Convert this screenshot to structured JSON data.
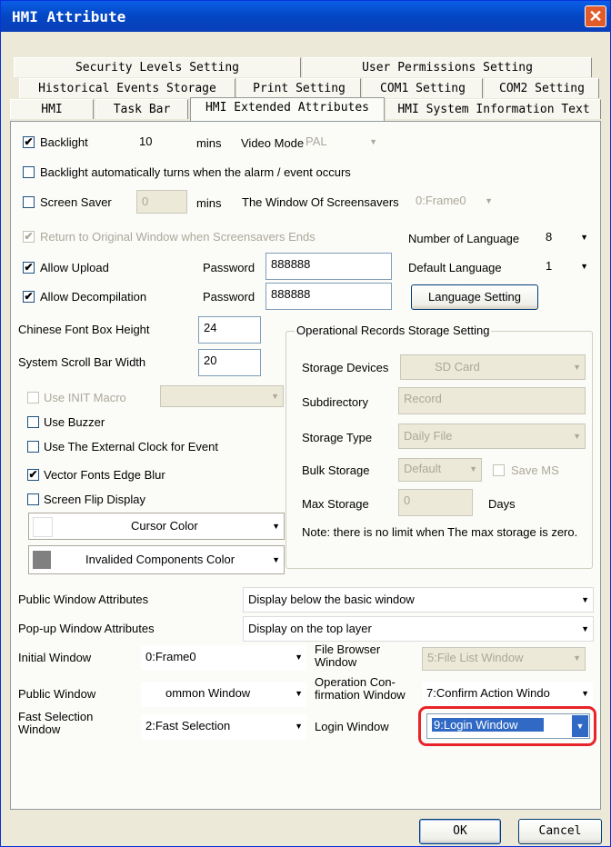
{
  "window": {
    "title": "HMI Attribute",
    "close_label": "✕"
  },
  "tabs": {
    "row1": [
      "Security Levels Setting",
      "User Permissions Setting"
    ],
    "row2": [
      "Historical Events Storage",
      "Print Setting",
      "COM1 Setting",
      "COM2 Setting"
    ],
    "row3": [
      "HMI",
      "Task Bar",
      "HMI Extended Attributes",
      "HMI System Information Text"
    ],
    "active": "HMI Extended Attributes"
  },
  "left": {
    "backlight": {
      "label": "Backlight",
      "checked": true,
      "value": "10",
      "unit": "mins"
    },
    "video_mode": {
      "label": "Video Mode",
      "value": "PAL"
    },
    "backlight_alarm": {
      "label": "Backlight automatically turns when the alarm / event occurs",
      "checked": false
    },
    "screen_saver": {
      "label": "Screen Saver",
      "checked": false,
      "value": "0",
      "unit": "mins"
    },
    "screensaver_window": {
      "label": "The Window Of Screensavers",
      "value": "0:Frame0"
    },
    "return_original": {
      "label": "Return to Original Window when Screensavers Ends",
      "checked": true
    },
    "allow_upload": {
      "label": "Allow Upload",
      "checked": true,
      "password_label": "Password",
      "password": "888888"
    },
    "allow_decompilation": {
      "label": "Allow Decompilation",
      "checked": true,
      "password_label": "Password",
      "password": "888888"
    },
    "font_box_height": {
      "label": "Chinese Font Box Height",
      "value": "24"
    },
    "scroll_bar_width": {
      "label": "System Scroll Bar Width",
      "value": "20"
    },
    "use_init_macro": {
      "label": "Use INIT Macro",
      "checked": false
    },
    "use_buzzer": {
      "label": "Use Buzzer",
      "checked": false
    },
    "external_clock": {
      "label": "Use The External Clock for Event",
      "checked": false
    },
    "vector_fonts": {
      "label": "Vector Fonts Edge Blur",
      "checked": true
    },
    "screen_flip": {
      "label": "Screen Flip Display",
      "checked": false
    },
    "cursor_color": {
      "label": "Cursor Color",
      "swatch": "#ffffff"
    },
    "invalided_color": {
      "label": "Invalided Components Color",
      "swatch": "#808080"
    }
  },
  "right": {
    "num_language": {
      "label": "Number of Language",
      "value": "8"
    },
    "default_language": {
      "label": "Default Language",
      "value": "1"
    },
    "language_button": "Language Setting",
    "records": {
      "title": "Operational Records Storage Setting",
      "storage_devices": {
        "label": "Storage Devices",
        "value": "SD Card"
      },
      "subdirectory": {
        "label": "Subdirectory",
        "value": "Record"
      },
      "storage_type": {
        "label": "Storage Type",
        "value": "Daily File"
      },
      "bulk_storage": {
        "label": "Bulk Storage",
        "value": "Default"
      },
      "save_ms": {
        "label": "Save MS",
        "checked": false
      },
      "max_storage": {
        "label": "Max Storage",
        "value": "0",
        "unit": "Days"
      },
      "note": "Note: there is no limit when The max storage is zero."
    }
  },
  "bottom": {
    "public_attr": {
      "label": "Public Window Attributes",
      "value": "Display below the basic window"
    },
    "popup_attr": {
      "label": "Pop-up Window Attributes",
      "value": "Display on the top layer"
    },
    "initial_window": {
      "label": "Initial Window",
      "value": "0:Frame0"
    },
    "file_browser": {
      "label": "File Browser Window",
      "value": "5:File List Window"
    },
    "public_window": {
      "label": "Public Window",
      "value": "ommon Window"
    },
    "operation_confirm": {
      "label": "Operation Con- firmation Window",
      "value": "7:Confirm Action Windo"
    },
    "fast_selection": {
      "label": "Fast Selection Window",
      "value": "2:Fast Selection"
    },
    "login_window": {
      "label": "Login Window",
      "value": "9:Login Window"
    },
    "highlight_color": "#e8232a"
  },
  "buttons": {
    "ok": "OK",
    "cancel": "Cancel"
  }
}
